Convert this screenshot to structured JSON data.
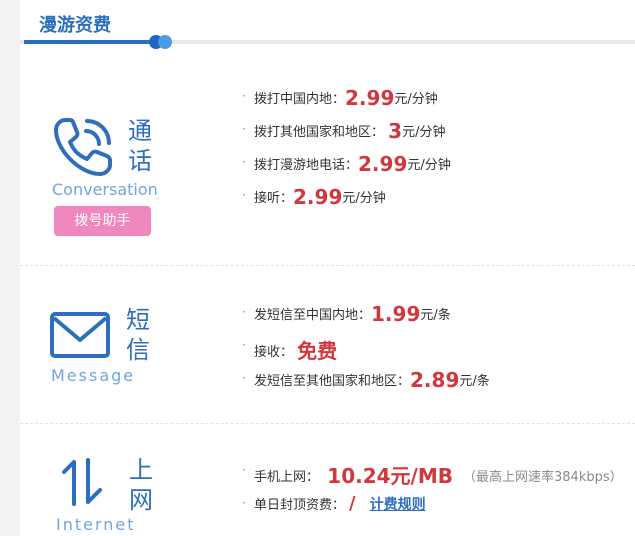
{
  "header": {
    "title": "漫游资费"
  },
  "call": {
    "cn_char_1": "通",
    "cn_char_2": "话",
    "en_label": "Conversation",
    "helper_button": "拨号助手",
    "rates": [
      {
        "label": "拨打中国内地：",
        "price": "2.99",
        "unit": "元/分钟"
      },
      {
        "label": "拨打其他国家和地区：",
        "price": "3",
        "unit": "元/分钟"
      },
      {
        "label": "拨打漫游地电话：",
        "price": "2.99",
        "unit": "元/分钟"
      },
      {
        "label": "接听：",
        "price": "2.99",
        "unit": "元/分钟"
      }
    ]
  },
  "message": {
    "cn_char_1": "短",
    "cn_char_2": "信",
    "en_label": "Message",
    "rates": [
      {
        "label": "发短信至中国内地：",
        "price": "1.99",
        "unit": "元/条"
      },
      {
        "label": "接收：",
        "price": "免费",
        "unit": ""
      },
      {
        "label": "发短信至其他国家和地区：",
        "price": "2.89",
        "unit": "元/条"
      }
    ]
  },
  "internet": {
    "cn_char_1": "上",
    "cn_char_2": "网",
    "en_label": "Internet",
    "mobile_label": "手机上网：",
    "mobile_price": "10.24元/MB",
    "mobile_note": "（最高上网速率384kbps）",
    "daily_cap_label": "单日封顶资费：",
    "daily_cap_value": "/",
    "billing_rules_link": "计费规则"
  },
  "colors": {
    "brand_blue": "#2d6ebd",
    "price_red": "#d2373d",
    "button_pink": "#f088bf"
  }
}
